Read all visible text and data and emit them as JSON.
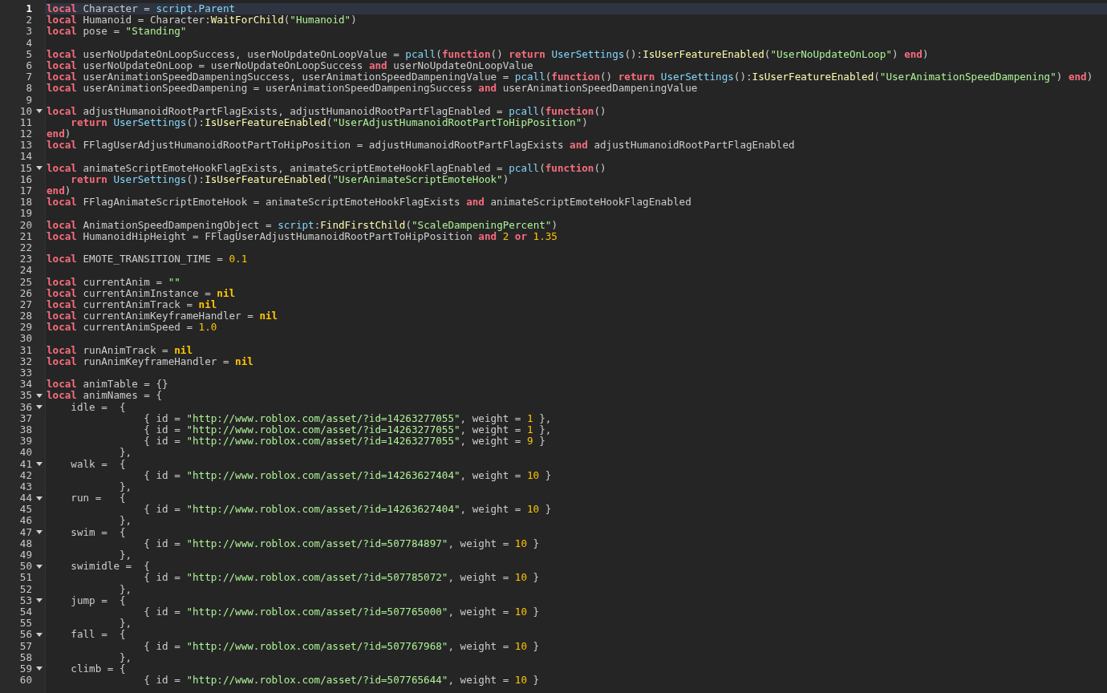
{
  "editor": {
    "lines": [
      {
        "number": "1",
        "current": true,
        "fold": false,
        "tokens": [
          {
            "kind": "keyword",
            "text": "local"
          },
          {
            "kind": "plain",
            "text": " Character = "
          },
          {
            "kind": "builtin",
            "text": "script"
          },
          {
            "kind": "plain",
            "text": "."
          },
          {
            "kind": "builtin",
            "text": "Parent"
          }
        ]
      },
      {
        "number": "2",
        "current": false,
        "fold": false,
        "tokens": [
          {
            "kind": "keyword",
            "text": "local"
          },
          {
            "kind": "plain",
            "text": " Humanoid = Character:"
          },
          {
            "kind": "method",
            "text": "WaitForChild"
          },
          {
            "kind": "plain",
            "text": "("
          },
          {
            "kind": "string",
            "text": "\"Humanoid\""
          },
          {
            "kind": "plain",
            "text": ")"
          }
        ]
      },
      {
        "number": "3",
        "current": false,
        "fold": false,
        "tokens": [
          {
            "kind": "keyword",
            "text": "local"
          },
          {
            "kind": "plain",
            "text": " pose = "
          },
          {
            "kind": "string",
            "text": "\"Standing\""
          }
        ]
      },
      {
        "number": "4",
        "current": false,
        "fold": false
      },
      {
        "number": "5",
        "current": false,
        "fold": false,
        "tokens": [
          {
            "kind": "keyword",
            "text": "local"
          },
          {
            "kind": "plain",
            "text": " userNoUpdateOnLoopSuccess, userNoUpdateOnLoopValue = "
          },
          {
            "kind": "builtin",
            "text": "pcall"
          },
          {
            "kind": "plain",
            "text": "("
          },
          {
            "kind": "keyword",
            "text": "function"
          },
          {
            "kind": "plain",
            "text": "() "
          },
          {
            "kind": "keyword",
            "text": "return"
          },
          {
            "kind": "builtin",
            "text": " UserSettings"
          },
          {
            "kind": "plain",
            "text": "():"
          },
          {
            "kind": "method",
            "text": "IsUserFeatureEnabled"
          },
          {
            "kind": "plain",
            "text": "("
          },
          {
            "kind": "string",
            "text": "\"UserNoUpdateOnLoop\""
          },
          {
            "kind": "plain",
            "text": ") "
          },
          {
            "kind": "keyword",
            "text": "end"
          },
          {
            "kind": "plain",
            "text": ")"
          }
        ]
      },
      {
        "number": "6",
        "current": false,
        "fold": false,
        "tokens": [
          {
            "kind": "keyword",
            "text": "local"
          },
          {
            "kind": "plain",
            "text": " userNoUpdateOnLoop = userNoUpdateOnLoopSuccess "
          },
          {
            "kind": "keyword",
            "text": "and"
          },
          {
            "kind": "plain",
            "text": " userNoUpdateOnLoopValue"
          }
        ]
      },
      {
        "number": "7",
        "current": false,
        "fold": false,
        "tokens": [
          {
            "kind": "keyword",
            "text": "local"
          },
          {
            "kind": "plain",
            "text": " userAnimationSpeedDampeningSuccess, userAnimationSpeedDampeningValue = "
          },
          {
            "kind": "builtin",
            "text": "pcall"
          },
          {
            "kind": "plain",
            "text": "("
          },
          {
            "kind": "keyword",
            "text": "function"
          },
          {
            "kind": "plain",
            "text": "() "
          },
          {
            "kind": "keyword",
            "text": "return"
          },
          {
            "kind": "builtin",
            "text": " UserSettings"
          },
          {
            "kind": "plain",
            "text": "():"
          },
          {
            "kind": "method",
            "text": "IsUserFeatureEnabled"
          },
          {
            "kind": "plain",
            "text": "("
          },
          {
            "kind": "string",
            "text": "\"UserAnimationSpeedDampening\""
          },
          {
            "kind": "plain",
            "text": ") "
          },
          {
            "kind": "keyword",
            "text": "end"
          },
          {
            "kind": "plain",
            "text": ")"
          }
        ]
      },
      {
        "number": "8",
        "current": false,
        "fold": false,
        "tokens": [
          {
            "kind": "keyword",
            "text": "local"
          },
          {
            "kind": "plain",
            "text": " userAnimationSpeedDampening = userAnimationSpeedDampeningSuccess "
          },
          {
            "kind": "keyword",
            "text": "and"
          },
          {
            "kind": "plain",
            "text": " userAnimationSpeedDampeningValue"
          }
        ]
      },
      {
        "number": "9",
        "current": false,
        "fold": false
      },
      {
        "number": "10",
        "current": false,
        "fold": true,
        "tokens": [
          {
            "kind": "keyword",
            "text": "local"
          },
          {
            "kind": "plain",
            "text": " adjustHumanoidRootPartFlagExists, adjustHumanoidRootPartFlagEnabled = "
          },
          {
            "kind": "builtin",
            "text": "pcall"
          },
          {
            "kind": "plain",
            "text": "("
          },
          {
            "kind": "keyword",
            "text": "function"
          },
          {
            "kind": "plain",
            "text": "()"
          }
        ]
      },
      {
        "number": "11",
        "current": false,
        "fold": false,
        "tokens": [
          {
            "kind": "keyword",
            "text": "    return"
          },
          {
            "kind": "builtin",
            "text": " UserSettings"
          },
          {
            "kind": "plain",
            "text": "():"
          },
          {
            "kind": "method",
            "text": "IsUserFeatureEnabled"
          },
          {
            "kind": "plain",
            "text": "("
          },
          {
            "kind": "string",
            "text": "\"UserAdjustHumanoidRootPartToHipPosition\""
          },
          {
            "kind": "plain",
            "text": ")"
          }
        ]
      },
      {
        "number": "12",
        "current": false,
        "fold": false,
        "tokens": [
          {
            "kind": "keyword",
            "text": "end"
          },
          {
            "kind": "plain",
            "text": ")"
          }
        ]
      },
      {
        "number": "13",
        "current": false,
        "fold": false,
        "tokens": [
          {
            "kind": "keyword",
            "text": "local"
          },
          {
            "kind": "plain",
            "text": " FFlagUserAdjustHumanoidRootPartToHipPosition = adjustHumanoidRootPartFlagExists "
          },
          {
            "kind": "keyword",
            "text": "and"
          },
          {
            "kind": "plain",
            "text": " adjustHumanoidRootPartFlagEnabled"
          }
        ]
      },
      {
        "number": "14",
        "current": false,
        "fold": false
      },
      {
        "number": "15",
        "current": false,
        "fold": true,
        "tokens": [
          {
            "kind": "keyword",
            "text": "local"
          },
          {
            "kind": "plain",
            "text": " animateScriptEmoteHookFlagExists, animateScriptEmoteHookFlagEnabled = "
          },
          {
            "kind": "builtin",
            "text": "pcall"
          },
          {
            "kind": "plain",
            "text": "("
          },
          {
            "kind": "keyword",
            "text": "function"
          },
          {
            "kind": "plain",
            "text": "()"
          }
        ]
      },
      {
        "number": "16",
        "current": false,
        "fold": false,
        "tokens": [
          {
            "kind": "keyword",
            "text": "    return"
          },
          {
            "kind": "builtin",
            "text": " UserSettings"
          },
          {
            "kind": "plain",
            "text": "():"
          },
          {
            "kind": "method",
            "text": "IsUserFeatureEnabled"
          },
          {
            "kind": "plain",
            "text": "("
          },
          {
            "kind": "string",
            "text": "\"UserAnimateScriptEmoteHook\""
          },
          {
            "kind": "plain",
            "text": ")"
          }
        ]
      },
      {
        "number": "17",
        "current": false,
        "fold": false,
        "tokens": [
          {
            "kind": "keyword",
            "text": "end"
          },
          {
            "kind": "plain",
            "text": ")"
          }
        ]
      },
      {
        "number": "18",
        "current": false,
        "fold": false,
        "tokens": [
          {
            "kind": "keyword",
            "text": "local"
          },
          {
            "kind": "plain",
            "text": " FFlagAnimateScriptEmoteHook = animateScriptEmoteHookFlagExists "
          },
          {
            "kind": "keyword",
            "text": "and"
          },
          {
            "kind": "plain",
            "text": " animateScriptEmoteHookFlagEnabled"
          }
        ]
      },
      {
        "number": "19",
        "current": false,
        "fold": false
      },
      {
        "number": "20",
        "current": false,
        "fold": false,
        "tokens": [
          {
            "kind": "keyword",
            "text": "local"
          },
          {
            "kind": "plain",
            "text": " AnimationSpeedDampeningObject = "
          },
          {
            "kind": "builtin",
            "text": "script"
          },
          {
            "kind": "plain",
            "text": ":"
          },
          {
            "kind": "method",
            "text": "FindFirstChild"
          },
          {
            "kind": "plain",
            "text": "("
          },
          {
            "kind": "string",
            "text": "\"ScaleDampeningPercent\""
          },
          {
            "kind": "plain",
            "text": ")"
          }
        ]
      },
      {
        "number": "21",
        "current": false,
        "fold": false,
        "tokens": [
          {
            "kind": "keyword",
            "text": "local"
          },
          {
            "kind": "plain",
            "text": " HumanoidHipHeight = FFlagUserAdjustHumanoidRootPartToHipPosition "
          },
          {
            "kind": "keyword",
            "text": "and"
          },
          {
            "kind": "number",
            "text": " 2"
          },
          {
            "kind": "keyword",
            "text": " or"
          },
          {
            "kind": "number",
            "text": " 1.35"
          }
        ]
      },
      {
        "number": "22",
        "current": false,
        "fold": false
      },
      {
        "number": "23",
        "current": false,
        "fold": false,
        "tokens": [
          {
            "kind": "keyword",
            "text": "local"
          },
          {
            "kind": "plain",
            "text": " EMOTE_TRANSITION_TIME = "
          },
          {
            "kind": "number",
            "text": "0.1"
          }
        ]
      },
      {
        "number": "24",
        "current": false,
        "fold": false
      },
      {
        "number": "25",
        "current": false,
        "fold": false,
        "tokens": [
          {
            "kind": "keyword",
            "text": "local"
          },
          {
            "kind": "plain",
            "text": " currentAnim = "
          },
          {
            "kind": "string",
            "text": "\"\""
          }
        ]
      },
      {
        "number": "26",
        "current": false,
        "fold": false,
        "tokens": [
          {
            "kind": "keyword",
            "text": "local"
          },
          {
            "kind": "plain",
            "text": " currentAnimInstance = "
          },
          {
            "kind": "nil",
            "text": "nil"
          }
        ]
      },
      {
        "number": "27",
        "current": false,
        "fold": false,
        "tokens": [
          {
            "kind": "keyword",
            "text": "local"
          },
          {
            "kind": "plain",
            "text": " currentAnimTrack = "
          },
          {
            "kind": "nil",
            "text": "nil"
          }
        ]
      },
      {
        "number": "28",
        "current": false,
        "fold": false,
        "tokens": [
          {
            "kind": "keyword",
            "text": "local"
          },
          {
            "kind": "plain",
            "text": " currentAnimKeyframeHandler = "
          },
          {
            "kind": "nil",
            "text": "nil"
          }
        ]
      },
      {
        "number": "29",
        "current": false,
        "fold": false,
        "tokens": [
          {
            "kind": "keyword",
            "text": "local"
          },
          {
            "kind": "plain",
            "text": " currentAnimSpeed = "
          },
          {
            "kind": "number",
            "text": "1.0"
          }
        ]
      },
      {
        "number": "30",
        "current": false,
        "fold": false
      },
      {
        "number": "31",
        "current": false,
        "fold": false,
        "tokens": [
          {
            "kind": "keyword",
            "text": "local"
          },
          {
            "kind": "plain",
            "text": " runAnimTrack = "
          },
          {
            "kind": "nil",
            "text": "nil"
          }
        ]
      },
      {
        "number": "32",
        "current": false,
        "fold": false,
        "tokens": [
          {
            "kind": "keyword",
            "text": "local"
          },
          {
            "kind": "plain",
            "text": " runAnimKeyframeHandler = "
          },
          {
            "kind": "nil",
            "text": "nil"
          }
        ]
      },
      {
        "number": "33",
        "current": false,
        "fold": false
      },
      {
        "number": "34",
        "current": false,
        "fold": false,
        "tokens": [
          {
            "kind": "keyword",
            "text": "local"
          },
          {
            "kind": "plain",
            "text": " animTable = {}"
          }
        ]
      },
      {
        "number": "35",
        "current": false,
        "fold": true,
        "tokens": [
          {
            "kind": "keyword",
            "text": "local"
          },
          {
            "kind": "plain",
            "text": " animNames = {"
          }
        ]
      },
      {
        "number": "36",
        "current": false,
        "fold": true,
        "tokens": [
          {
            "kind": "plain",
            "text": "    idle =  {"
          }
        ]
      },
      {
        "number": "37",
        "current": false,
        "fold": false,
        "tokens": [
          {
            "kind": "plain",
            "text": "                { id = "
          },
          {
            "kind": "string",
            "text": "\"http://www.roblox.com/asset/?id=14263277055\""
          },
          {
            "kind": "plain",
            "text": ", weight = "
          },
          {
            "kind": "number",
            "text": "1"
          },
          {
            "kind": "plain",
            "text": " },"
          }
        ]
      },
      {
        "number": "38",
        "current": false,
        "fold": false,
        "tokens": [
          {
            "kind": "plain",
            "text": "                { id = "
          },
          {
            "kind": "string",
            "text": "\"http://www.roblox.com/asset/?id=14263277055\""
          },
          {
            "kind": "plain",
            "text": ", weight = "
          },
          {
            "kind": "number",
            "text": "1"
          },
          {
            "kind": "plain",
            "text": " },"
          }
        ]
      },
      {
        "number": "39",
        "current": false,
        "fold": false,
        "tokens": [
          {
            "kind": "plain",
            "text": "                { id = "
          },
          {
            "kind": "string",
            "text": "\"http://www.roblox.com/asset/?id=14263277055\""
          },
          {
            "kind": "plain",
            "text": ", weight = "
          },
          {
            "kind": "number",
            "text": "9"
          },
          {
            "kind": "plain",
            "text": " }"
          }
        ]
      },
      {
        "number": "40",
        "current": false,
        "fold": false,
        "tokens": [
          {
            "kind": "plain",
            "text": "            },"
          }
        ]
      },
      {
        "number": "41",
        "current": false,
        "fold": true,
        "tokens": [
          {
            "kind": "plain",
            "text": "    walk =  {"
          }
        ]
      },
      {
        "number": "42",
        "current": false,
        "fold": false,
        "tokens": [
          {
            "kind": "plain",
            "text": "                { id = "
          },
          {
            "kind": "string",
            "text": "\"http://www.roblox.com/asset/?id=14263627404\""
          },
          {
            "kind": "plain",
            "text": ", weight = "
          },
          {
            "kind": "number",
            "text": "10"
          },
          {
            "kind": "plain",
            "text": " }"
          }
        ]
      },
      {
        "number": "43",
        "current": false,
        "fold": false,
        "tokens": [
          {
            "kind": "plain",
            "text": "            },"
          }
        ]
      },
      {
        "number": "44",
        "current": false,
        "fold": true,
        "tokens": [
          {
            "kind": "plain",
            "text": "    run =   {"
          }
        ]
      },
      {
        "number": "45",
        "current": false,
        "fold": false,
        "tokens": [
          {
            "kind": "plain",
            "text": "                { id = "
          },
          {
            "kind": "string",
            "text": "\"http://www.roblox.com/asset/?id=14263627404\""
          },
          {
            "kind": "plain",
            "text": ", weight = "
          },
          {
            "kind": "number",
            "text": "10"
          },
          {
            "kind": "plain",
            "text": " }"
          }
        ]
      },
      {
        "number": "46",
        "current": false,
        "fold": false,
        "tokens": [
          {
            "kind": "plain",
            "text": "            },"
          }
        ]
      },
      {
        "number": "47",
        "current": false,
        "fold": true,
        "tokens": [
          {
            "kind": "plain",
            "text": "    swim =  {"
          }
        ]
      },
      {
        "number": "48",
        "current": false,
        "fold": false,
        "tokens": [
          {
            "kind": "plain",
            "text": "                { id = "
          },
          {
            "kind": "string",
            "text": "\"http://www.roblox.com/asset/?id=507784897\""
          },
          {
            "kind": "plain",
            "text": ", weight = "
          },
          {
            "kind": "number",
            "text": "10"
          },
          {
            "kind": "plain",
            "text": " }"
          }
        ]
      },
      {
        "number": "49",
        "current": false,
        "fold": false,
        "tokens": [
          {
            "kind": "plain",
            "text": "            },"
          }
        ]
      },
      {
        "number": "50",
        "current": false,
        "fold": true,
        "tokens": [
          {
            "kind": "plain",
            "text": "    swimidle =  {"
          }
        ]
      },
      {
        "number": "51",
        "current": false,
        "fold": false,
        "tokens": [
          {
            "kind": "plain",
            "text": "                { id = "
          },
          {
            "kind": "string",
            "text": "\"http://www.roblox.com/asset/?id=507785072\""
          },
          {
            "kind": "plain",
            "text": ", weight = "
          },
          {
            "kind": "number",
            "text": "10"
          },
          {
            "kind": "plain",
            "text": " }"
          }
        ]
      },
      {
        "number": "52",
        "current": false,
        "fold": false,
        "tokens": [
          {
            "kind": "plain",
            "text": "            },"
          }
        ]
      },
      {
        "number": "53",
        "current": false,
        "fold": true,
        "tokens": [
          {
            "kind": "plain",
            "text": "    jump =  {"
          }
        ]
      },
      {
        "number": "54",
        "current": false,
        "fold": false,
        "tokens": [
          {
            "kind": "plain",
            "text": "                { id = "
          },
          {
            "kind": "string",
            "text": "\"http://www.roblox.com/asset/?id=507765000\""
          },
          {
            "kind": "plain",
            "text": ", weight = "
          },
          {
            "kind": "number",
            "text": "10"
          },
          {
            "kind": "plain",
            "text": " }"
          }
        ]
      },
      {
        "number": "55",
        "current": false,
        "fold": false,
        "tokens": [
          {
            "kind": "plain",
            "text": "            },"
          }
        ]
      },
      {
        "number": "56",
        "current": false,
        "fold": true,
        "tokens": [
          {
            "kind": "plain",
            "text": "    fall =  {"
          }
        ]
      },
      {
        "number": "57",
        "current": false,
        "fold": false,
        "tokens": [
          {
            "kind": "plain",
            "text": "                { id = "
          },
          {
            "kind": "string",
            "text": "\"http://www.roblox.com/asset/?id=507767968\""
          },
          {
            "kind": "plain",
            "text": ", weight = "
          },
          {
            "kind": "number",
            "text": "10"
          },
          {
            "kind": "plain",
            "text": " }"
          }
        ]
      },
      {
        "number": "58",
        "current": false,
        "fold": false,
        "tokens": [
          {
            "kind": "plain",
            "text": "            },"
          }
        ]
      },
      {
        "number": "59",
        "current": false,
        "fold": true,
        "tokens": [
          {
            "kind": "plain",
            "text": "    climb = {"
          }
        ]
      },
      {
        "number": "60",
        "current": false,
        "fold": false,
        "tokens": [
          {
            "kind": "plain",
            "text": "                { id = "
          },
          {
            "kind": "string",
            "text": "\"http://www.roblox.com/asset/?id=507765644\""
          },
          {
            "kind": "plain",
            "text": ", weight = "
          },
          {
            "kind": "number",
            "text": "10"
          },
          {
            "kind": "plain",
            "text": " }"
          }
        ]
      }
    ]
  }
}
